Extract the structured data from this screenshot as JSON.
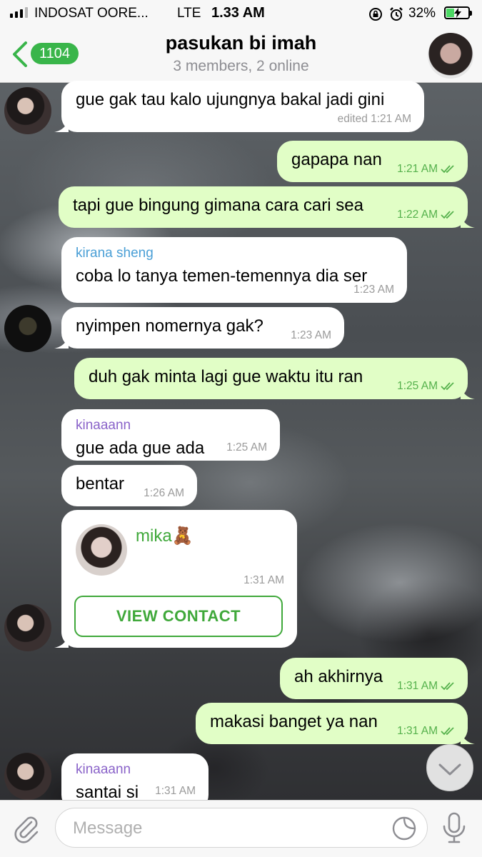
{
  "status_bar": {
    "carrier": "INDOSAT OORE...",
    "network": "LTE",
    "time": "1.33 AM",
    "battery": "32%"
  },
  "header": {
    "back_count": "1104",
    "title": "pasukan bi imah",
    "subtitle": "3 members, 2 online"
  },
  "messages": [
    {
      "dir": "in",
      "text": "gue gak tau kalo ujungnya bakal jadi gini",
      "time": "edited 1:21 AM"
    },
    {
      "dir": "out",
      "text": "gapapa nan",
      "time": "1:21 AM"
    },
    {
      "dir": "out",
      "text": "tapi gue bingung gimana cara cari sea",
      "time": "1:22 AM"
    },
    {
      "dir": "in",
      "sender": "kirana sheng",
      "sender_color": "#4a9fd6",
      "text": "coba lo tanya temen-temennya dia ser",
      "time": "1:23 AM"
    },
    {
      "dir": "in",
      "text": "nyimpen nomernya gak?",
      "time": "1:23 AM"
    },
    {
      "dir": "out",
      "text": "duh gak minta lagi gue waktu itu ran",
      "time": "1:25 AM"
    },
    {
      "dir": "in",
      "sender": "kinaaann",
      "sender_color": "#8a63c9",
      "text": "gue ada gue ada",
      "time": "1:25 AM"
    },
    {
      "dir": "in",
      "text": "bentar",
      "time": "1:26 AM"
    },
    {
      "dir": "in",
      "type": "contact",
      "contact_name": "mika🧸",
      "time": "1:31 AM",
      "button": "VIEW CONTACT"
    },
    {
      "dir": "out",
      "text": "ah akhirnya",
      "time": "1:31 AM"
    },
    {
      "dir": "out",
      "text": "makasi banget ya nan",
      "time": "1:31 AM"
    },
    {
      "dir": "in",
      "sender": "kinaaann",
      "sender_color": "#8a63c9",
      "text": "santai si",
      "time": "1:31 AM"
    }
  ],
  "input": {
    "placeholder": "Message"
  },
  "colors": {
    "accent": "#39b54a",
    "outgoing_bubble": "#e1fec6",
    "incoming_bubble": "#ffffff"
  },
  "icons": [
    "back-chevron-icon",
    "attach-paperclip-icon",
    "sticker-icon",
    "microphone-icon",
    "scroll-down-chevron-icon",
    "double-check-icon"
  ]
}
